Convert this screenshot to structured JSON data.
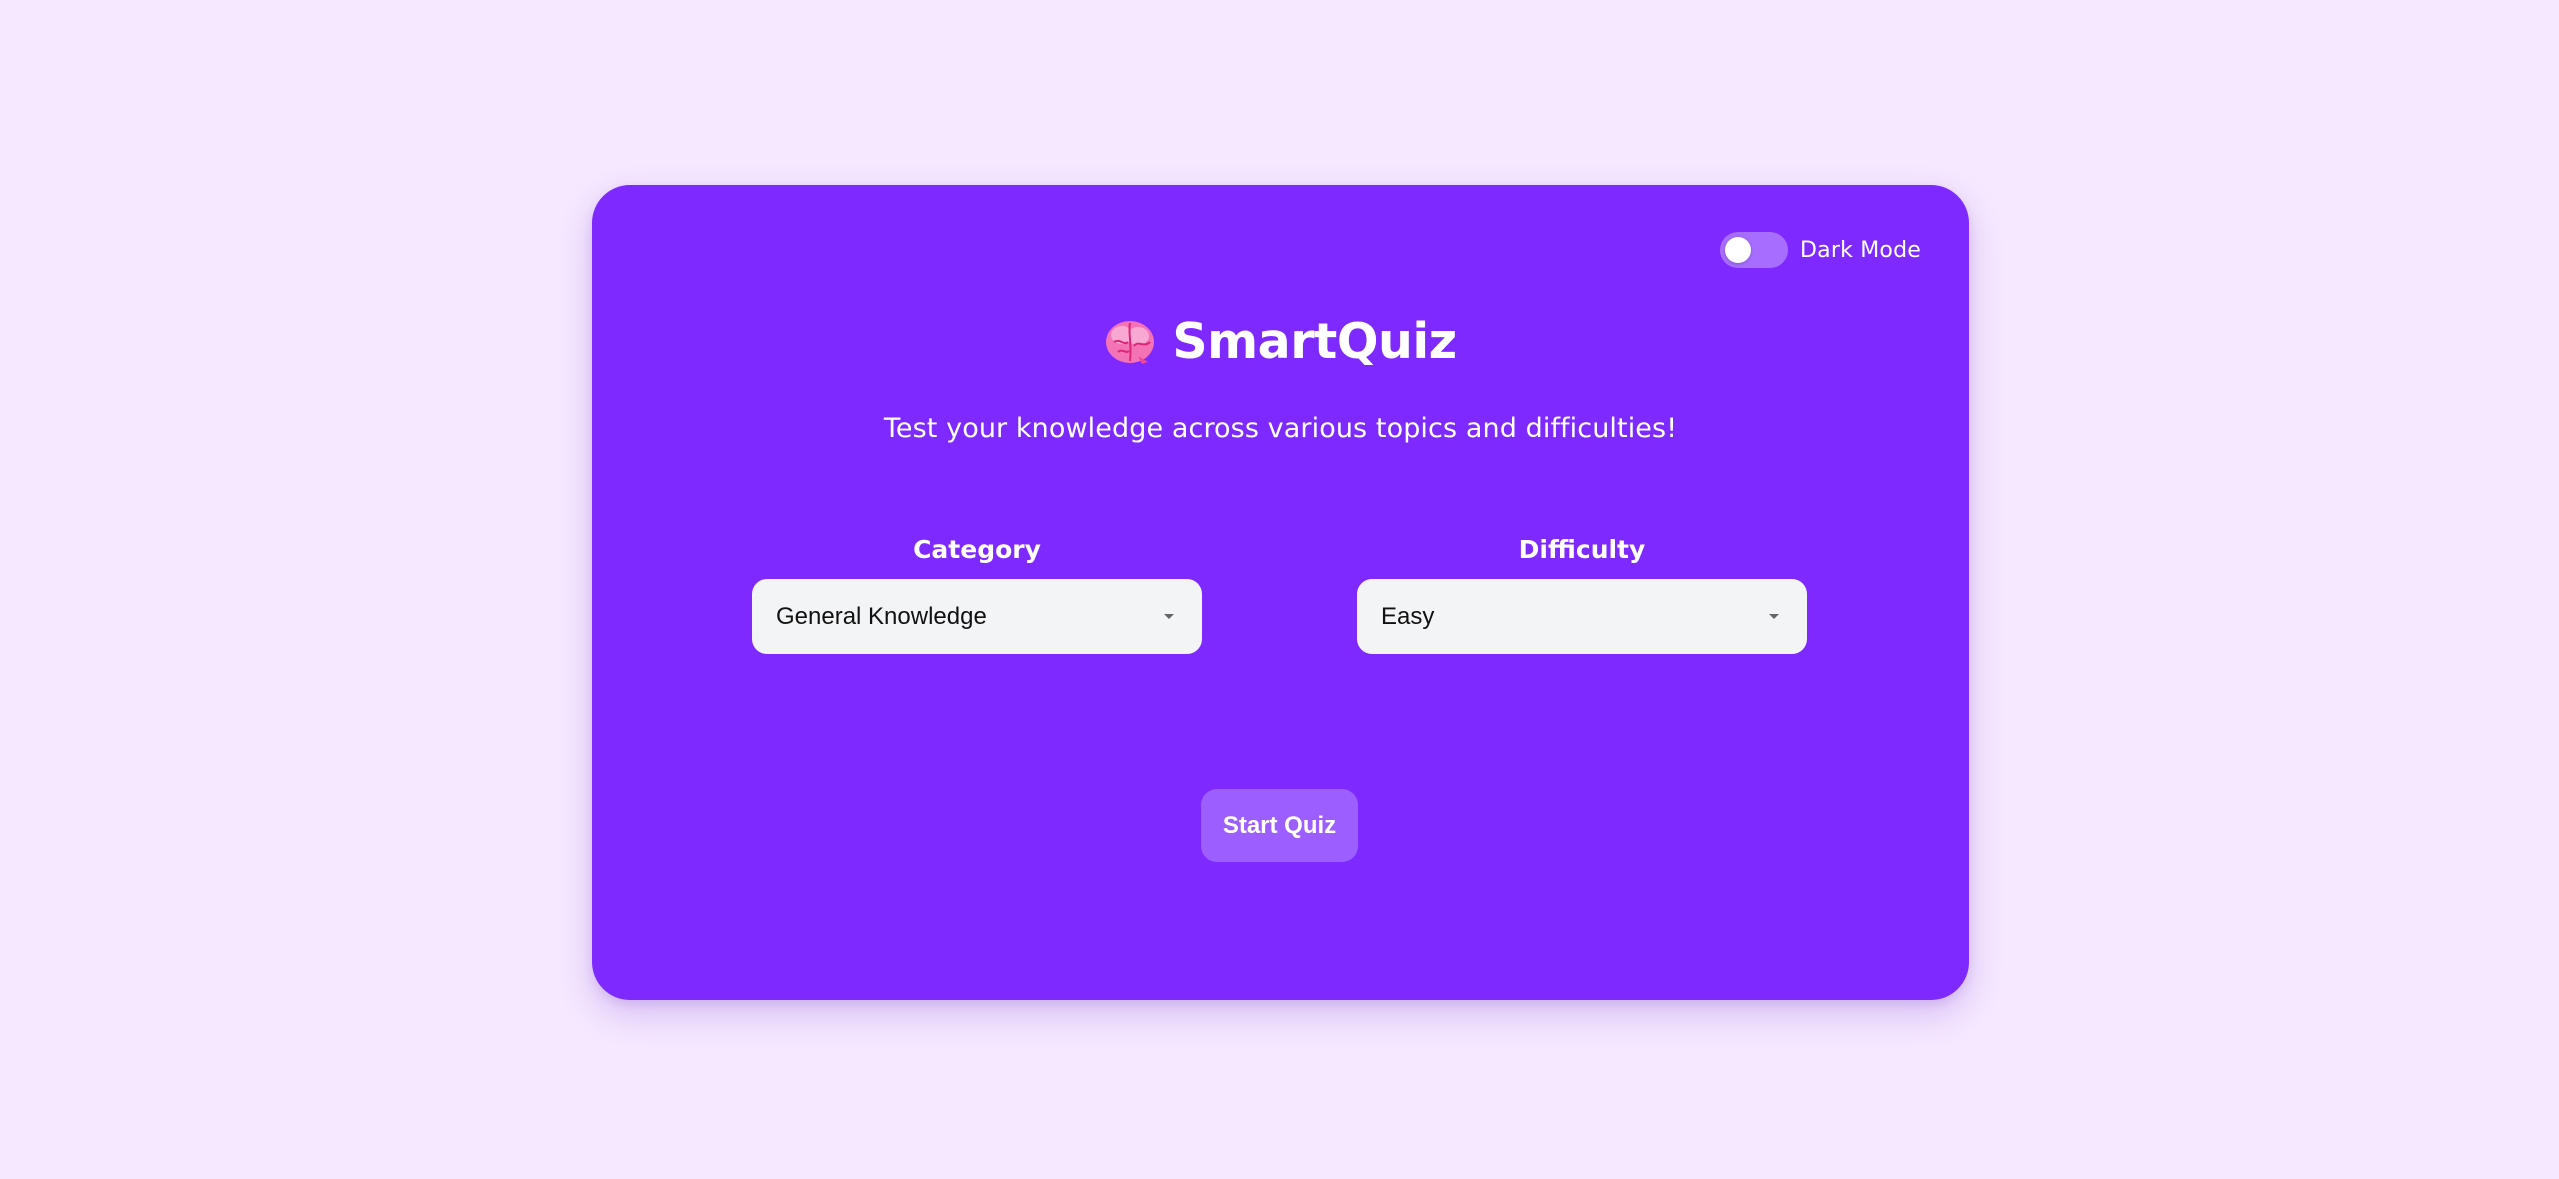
{
  "app": {
    "title": "SmartQuiz",
    "subtitle": "Test your knowledge across various topics and difficulties!",
    "icon": "brain-icon"
  },
  "dark_mode_toggle": {
    "label": "Dark Mode",
    "checked": false
  },
  "fields": {
    "category": {
      "label": "Category",
      "selected": "General Knowledge"
    },
    "difficulty": {
      "label": "Difficulty",
      "selected": "Easy"
    }
  },
  "actions": {
    "start_label": "Start Quiz"
  },
  "colors": {
    "page_background": "#f5e8ff",
    "card_background": "#7d29ff",
    "select_background": "#f3f4f6",
    "brain_icon": "#f472b6"
  }
}
